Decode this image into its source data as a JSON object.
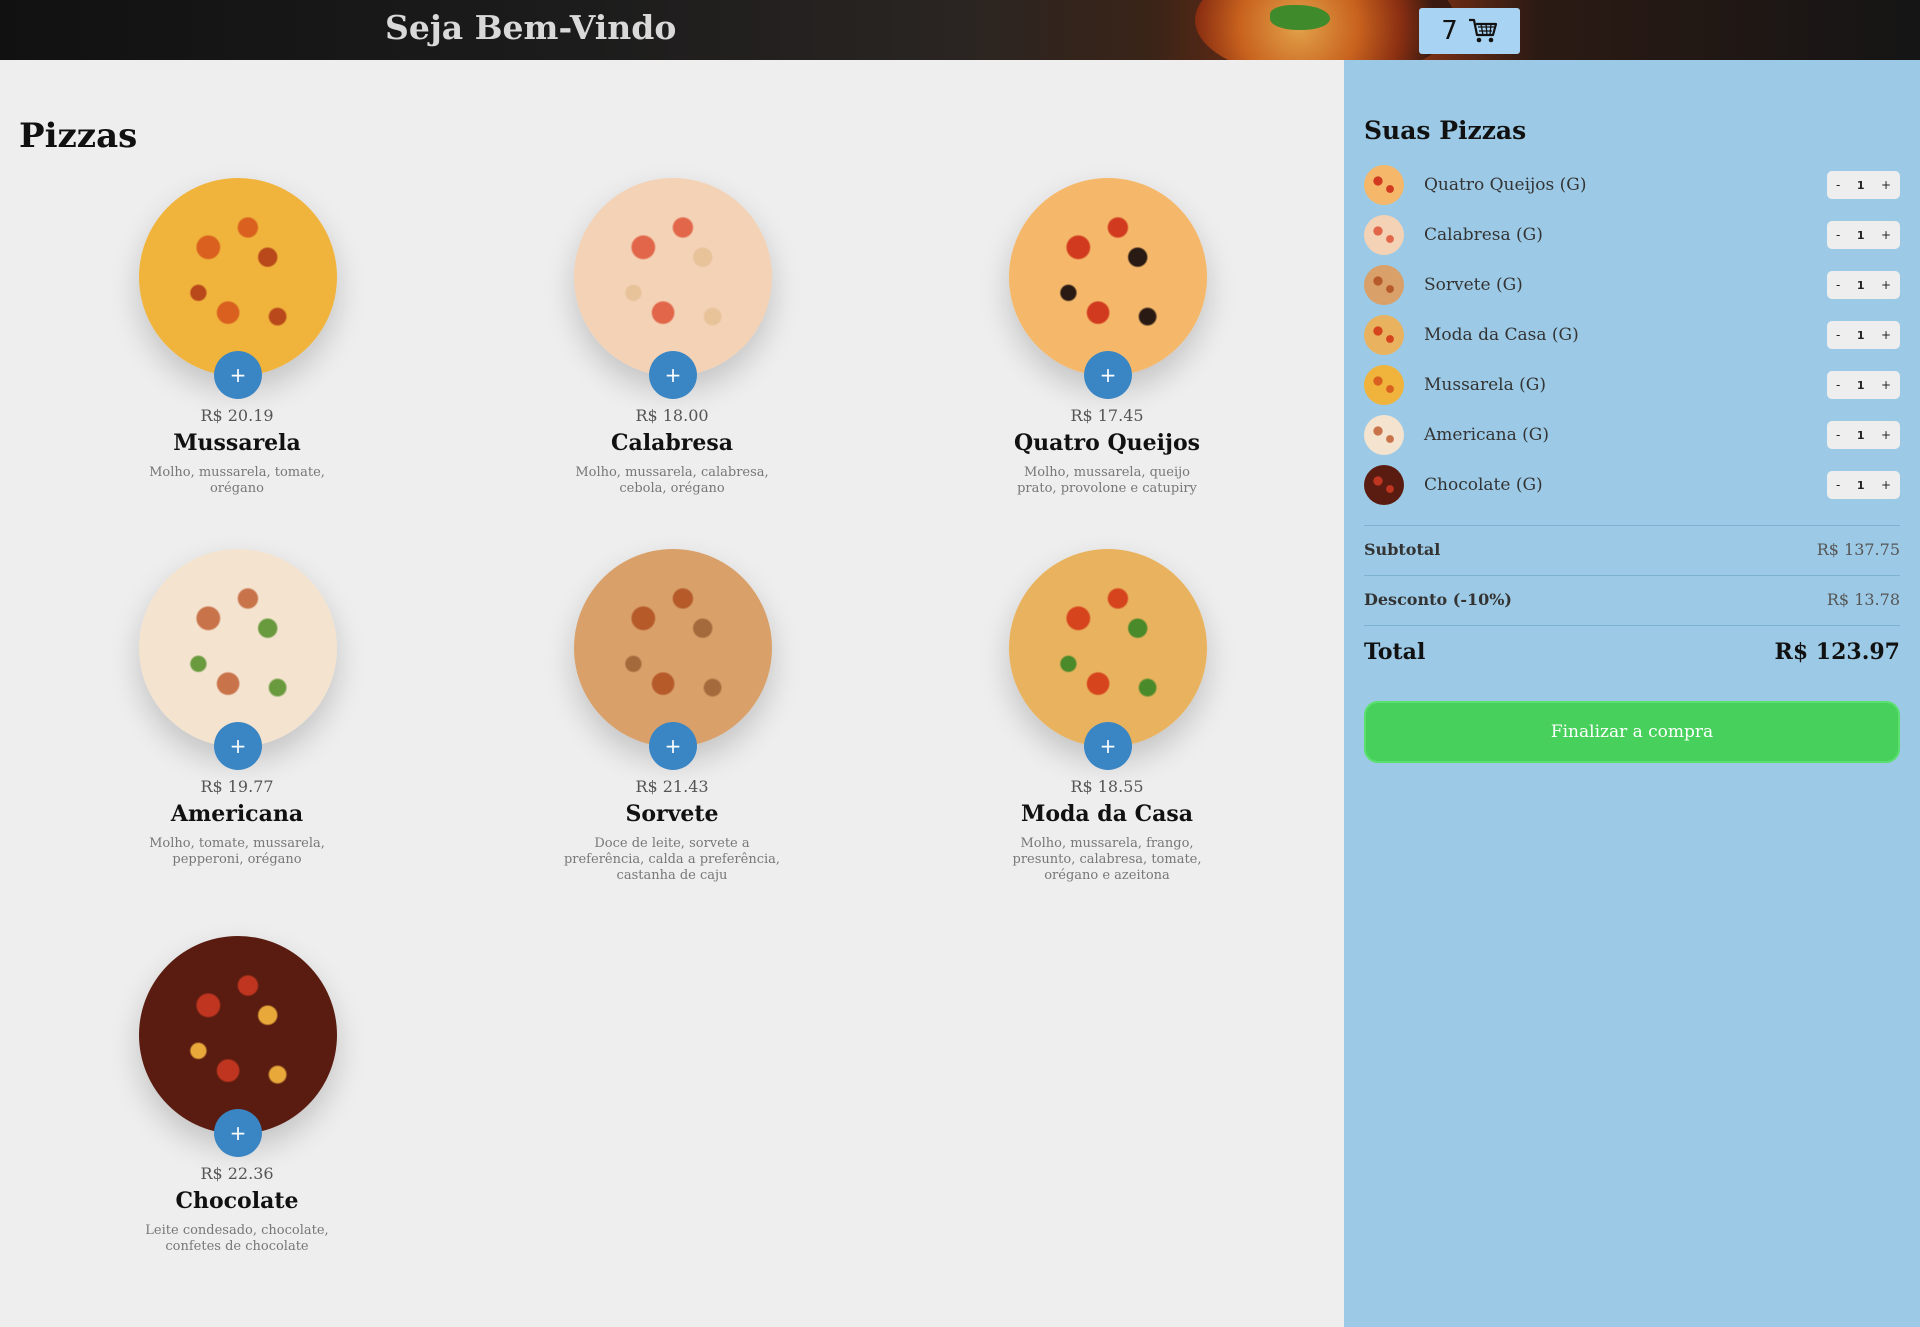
{
  "header": {
    "title": "Seja Bem-Vindo",
    "cart_count": "7",
    "cart_icon": "shopping-cart-icon"
  },
  "menu": {
    "title": "Pizzas",
    "add_label": "+",
    "pizzas": [
      {
        "name": "Mussarela",
        "price": "R$ 20.19",
        "desc": "Molho, mussarela, tomate, orégano",
        "colors": [
          "#f0b43c",
          "#d9601e",
          "#b9481a"
        ]
      },
      {
        "name": "Calabresa",
        "price": "R$ 18.00",
        "desc": "Molho, mussarela, calabresa, cebola, orégano",
        "colors": [
          "#f3d2b6",
          "#e2674a",
          "#e8c39a"
        ]
      },
      {
        "name": "Quatro Queijos",
        "price": "R$ 17.45",
        "desc": "Molho, mussarela, queijo prato, provolone e catupiry",
        "colors": [
          "#f5b86a",
          "#d13a1e",
          "#2a1a14"
        ]
      },
      {
        "name": "Americana",
        "price": "R$ 19.77",
        "desc": "Molho, tomate, mussarela, pepperoni, orégano",
        "colors": [
          "#f3e3cf",
          "#c9734a",
          "#6a9a3e"
        ]
      },
      {
        "name": "Sorvete",
        "price": "R$ 21.43",
        "desc": "Doce de leite, sorvete a preferência, calda a preferência, castanha de caju",
        "colors": [
          "#d9a06a",
          "#b65a2a",
          "#a56a3c"
        ]
      },
      {
        "name": "Moda da Casa",
        "price": "R$ 18.55",
        "desc": "Molho, mussarela, frango, presunto, calabresa, tomate, orégano e azeitona",
        "colors": [
          "#e9b25e",
          "#d6441e",
          "#4a8a2a"
        ]
      },
      {
        "name": "Chocolate",
        "price": "R$ 22.36",
        "desc": "Leite condesado, chocolate, confetes de chocolate",
        "colors": [
          "#5a1c10",
          "#c03520",
          "#e8a83a"
        ]
      }
    ]
  },
  "cart": {
    "title": "Suas Pizzas",
    "minus_label": "-",
    "plus_label": "+",
    "items": [
      {
        "name": "Quatro Queijos (G)",
        "qty": "1",
        "colors": [
          "#f5b86a",
          "#d13a1e"
        ]
      },
      {
        "name": "Calabresa (G)",
        "qty": "1",
        "colors": [
          "#f3d2b6",
          "#e2674a"
        ]
      },
      {
        "name": "Sorvete (G)",
        "qty": "1",
        "colors": [
          "#d9a06a",
          "#b65a2a"
        ]
      },
      {
        "name": "Moda da Casa (G)",
        "qty": "1",
        "colors": [
          "#e9b25e",
          "#d6441e"
        ]
      },
      {
        "name": "Mussarela (G)",
        "qty": "1",
        "colors": [
          "#f0b43c",
          "#d9601e"
        ]
      },
      {
        "name": "Americana (G)",
        "qty": "1",
        "colors": [
          "#f3e3cf",
          "#c9734a"
        ]
      },
      {
        "name": "Chocolate (G)",
        "qty": "1",
        "colors": [
          "#5a1c10",
          "#c03520"
        ]
      }
    ],
    "subtotal_label": "Subtotal",
    "subtotal_value": "R$ 137.75",
    "discount_label": "Desconto (-10%)",
    "discount_value": "R$ 13.78",
    "total_label": "Total",
    "total_value": "R$ 123.97",
    "checkout_label": "Finalizar a compra"
  },
  "colors": {
    "accent_blue": "#3a86c4",
    "sidebar_bg": "#9ccae6",
    "checkout_green": "#48d05c",
    "cart_badge": "#a8d3f2"
  }
}
